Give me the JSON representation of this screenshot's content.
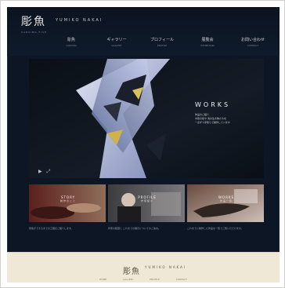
{
  "site": {
    "logo": {
      "kanji": "彫魚",
      "roman": "YUMIKO NAKAI",
      "sub": "CARVING FISH"
    },
    "nav": [
      {
        "jp": "彫魚",
        "en": "CARVING"
      },
      {
        "jp": "ギャラリー",
        "en": "GALLERY"
      },
      {
        "jp": "プロフィール",
        "en": "PROFILE"
      },
      {
        "jp": "展覧会",
        "en": "EXHIBITION"
      },
      {
        "jp": "お問い合わせ",
        "en": "CONTACT"
      }
    ]
  },
  "hero": {
    "title": "WORKS",
    "lines": [
      "作品のご紹介",
      "木彫の魚や 海の生き物たちを",
      "一点ずつ手彫りで制作しています"
    ],
    "controls": [
      "▶",
      "⤢"
    ]
  },
  "cards": [
    {
      "title": "STORY",
      "sub": "制作のこと",
      "caption": "彫魚ができるまでの工程をご紹介します。"
    },
    {
      "title": "PROFILE",
      "sub": "作家紹介",
      "caption": "作家の経歴と これまでの展示についてのご案内。"
    },
    {
      "title": "WORKS",
      "sub": "作品一覧",
      "caption": "これまでに制作した作品を一覧でご覧いただけます。"
    }
  ],
  "footer": {
    "kanji": "彫魚",
    "roman": "YUMIKO NAKAI",
    "links": [
      "HOME",
      "GALLERY",
      "PROFILE",
      "CONTACT"
    ]
  },
  "colors": {
    "background": "#0d1624",
    "footer": "#efe8d6",
    "accent": "#c9a24b"
  }
}
